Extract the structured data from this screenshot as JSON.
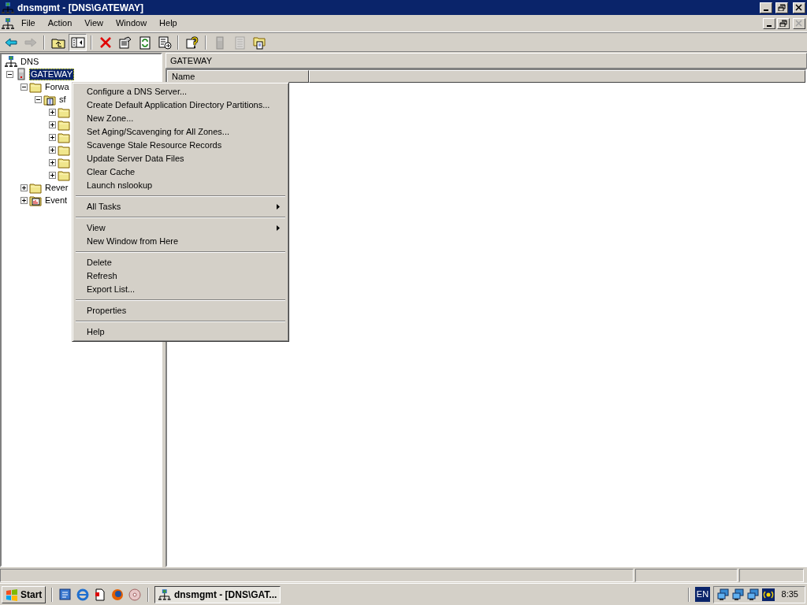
{
  "window": {
    "title": "dnsmgmt - [DNS\\GATEWAY]"
  },
  "menu_bar": [
    "File",
    "Action",
    "View",
    "Window",
    "Help"
  ],
  "mdi_buttons": [
    {
      "kind": "minimize",
      "disabled": false
    },
    {
      "kind": "restore",
      "disabled": false
    },
    {
      "kind": "close",
      "disabled": true
    }
  ],
  "toolbar": [
    {
      "kind": "back",
      "disabled": false,
      "pressed": false
    },
    {
      "kind": "forward",
      "disabled": true,
      "pressed": false
    },
    {
      "kind": "sep"
    },
    {
      "kind": "up",
      "disabled": false,
      "pressed": false
    },
    {
      "kind": "tree",
      "disabled": false,
      "pressed": true
    },
    {
      "kind": "sep"
    },
    {
      "kind": "delete",
      "disabled": false,
      "pressed": false
    },
    {
      "kind": "properties",
      "disabled": false,
      "pressed": false
    },
    {
      "kind": "refresh",
      "disabled": false,
      "pressed": false
    },
    {
      "kind": "export",
      "disabled": false,
      "pressed": false
    },
    {
      "kind": "sep"
    },
    {
      "kind": "help",
      "disabled": false,
      "pressed": false
    },
    {
      "kind": "sep"
    },
    {
      "kind": "server",
      "disabled": true,
      "pressed": false
    },
    {
      "kind": "list",
      "disabled": true,
      "pressed": false
    },
    {
      "kind": "folders",
      "disabled": false,
      "pressed": false
    }
  ],
  "tree": [
    {
      "label": "DNS",
      "kind": "dns",
      "selected": false,
      "children": [
        {
          "label": "GATEWAY",
          "kind": "server",
          "selected": true,
          "expanded": true,
          "children": [
            {
              "label": "Forwa",
              "kind": "folder",
              "selected": false,
              "expanded": true,
              "children": [
                {
                  "label": "sf",
                  "kind": "zone",
                  "selected": false,
                  "expanded": true,
                  "children": [
                    {
                      "kind": "folder",
                      "selected": false,
                      "expanded": false
                    },
                    {
                      "kind": "folder",
                      "selected": false,
                      "expanded": false
                    },
                    {
                      "kind": "folder",
                      "selected": false,
                      "expanded": false
                    },
                    {
                      "kind": "folder",
                      "selected": false,
                      "expanded": false
                    },
                    {
                      "kind": "folder",
                      "selected": false,
                      "expanded": false
                    },
                    {
                      "kind": "folder",
                      "selected": false,
                      "expanded": false
                    }
                  ]
                }
              ]
            },
            {
              "label": "Rever",
              "kind": "folder",
              "selected": false,
              "expanded": false
            },
            {
              "label": "Event",
              "kind": "eventlog",
              "selected": false,
              "expanded": false
            }
          ]
        }
      ]
    }
  ],
  "right_pane": {
    "title": "GATEWAY",
    "columns": [
      "Name"
    ]
  },
  "context_menu": [
    {
      "kind": "command",
      "label": "Configure a DNS Server..."
    },
    {
      "kind": "command",
      "label": "Create Default Application Directory Partitions..."
    },
    {
      "kind": "command",
      "label": "New Zone..."
    },
    {
      "kind": "command",
      "label": "Set Aging/Scavenging for All Zones..."
    },
    {
      "kind": "command",
      "label": "Scavenge Stale Resource Records"
    },
    {
      "kind": "command",
      "label": "Update Server Data Files"
    },
    {
      "kind": "command",
      "label": "Clear Cache"
    },
    {
      "kind": "command",
      "label": "Launch nslookup"
    },
    {
      "kind": "separator"
    },
    {
      "kind": "submenu",
      "label": "All Tasks"
    },
    {
      "kind": "separator"
    },
    {
      "kind": "submenu",
      "label": "View"
    },
    {
      "kind": "command",
      "label": "New Window from Here"
    },
    {
      "kind": "separator"
    },
    {
      "kind": "command",
      "label": "Delete"
    },
    {
      "kind": "command",
      "label": "Refresh"
    },
    {
      "kind": "command",
      "label": "Export List..."
    },
    {
      "kind": "separator"
    },
    {
      "kind": "command",
      "label": "Properties"
    },
    {
      "kind": "separator"
    },
    {
      "kind": "command",
      "label": "Help"
    }
  ],
  "taskbar": {
    "start": "Start",
    "tasks": [
      {
        "label": "dnsmgmt - [DNS\\GAT...",
        "selected": true
      }
    ],
    "language": "EN",
    "clock": "8:35"
  }
}
